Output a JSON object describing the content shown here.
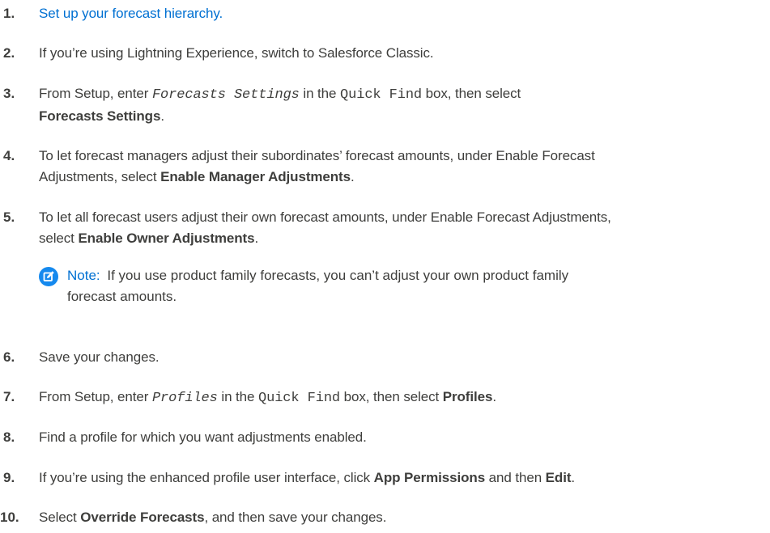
{
  "steps": [
    {
      "num": "1.",
      "link": "Set up your forecast hierarchy."
    },
    {
      "num": "2.",
      "text": "If you’re using Lightning Experience, switch to Salesforce Classic."
    },
    {
      "num": "3.",
      "p1": "From Setup, enter ",
      "code1": "Forecasts Settings",
      "p2": " in the ",
      "code2": "Quick Find",
      "p3": " box, then select ",
      "bold1": "Forecasts Settings",
      "p4": "."
    },
    {
      "num": "4.",
      "p1": "To let forecast managers adjust their subordinates’ forecast amounts, under Enable Forecast",
      "p2": "Adjustments, select ",
      "bold1": "Enable Manager Adjustments",
      "p3": "."
    },
    {
      "num": "5.",
      "p1": "To let all forecast users adjust their own forecast amounts, under Enable Forecast Adjustments,",
      "p2": "select ",
      "bold1": "Enable Owner Adjustments",
      "p3": "."
    },
    {
      "num": "6.",
      "text": "Save your changes."
    },
    {
      "num": "7.",
      "p1": "From Setup, enter ",
      "code1": "Profiles",
      "p2": " in the ",
      "code2": "Quick Find",
      "p3": " box, then select ",
      "bold1": "Profiles",
      "p4": "."
    },
    {
      "num": "8.",
      "text": "Find a profile for which you want adjustments enabled."
    },
    {
      "num": "9.",
      "p1": "If you’re using the enhanced profile user interface, click ",
      "bold1": "App Permissions",
      "p2": " and then ",
      "bold2": "Edit",
      "p3": "."
    },
    {
      "num": "10.",
      "p1": "Select ",
      "bold1": "Override Forecasts",
      "p2": ", and then save your changes."
    }
  ],
  "note": {
    "label": "Note:",
    "line1": "If you use product family forecasts, you can’t adjust your own product family",
    "line2": "forecast amounts.",
    "icon": "edit-note-icon",
    "icon_color": "#1589ee"
  },
  "colors": {
    "link": "#0070d2",
    "text": "#3e3e3c"
  }
}
